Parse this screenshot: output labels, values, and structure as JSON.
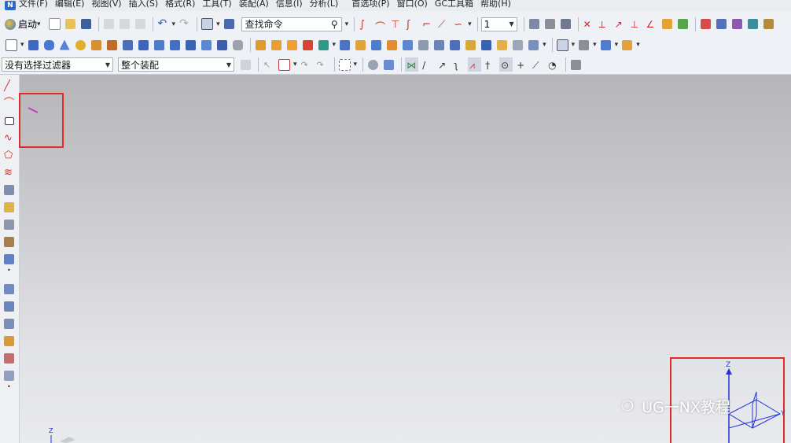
{
  "menubar": {
    "items": [
      "文件(F)",
      "编辑(E)",
      "视图(V)",
      "插入(S)",
      "格式(R)",
      "工具(T)",
      "装配(A)",
      "信息(I)",
      "分析(L)",
      "首选项(P)",
      "窗口(O)",
      "GC工具箱",
      "帮助(H)"
    ]
  },
  "toolbar1": {
    "start_label": "启动",
    "search_placeholder": "查找命令",
    "layer_value": "1"
  },
  "toolbar3": {
    "filter_value": "没有选择过滤器",
    "assembly_value": "整个装配"
  },
  "viewport": {
    "triad_z_label": "Z",
    "triad_y_label": "Y",
    "small_triad_label": "Z"
  },
  "watermark": {
    "text": "UG一NX教程",
    "icon": "wechat-icon"
  },
  "colors": {
    "highlight": "#e22a2a",
    "axis_blue": "#2233dd"
  }
}
